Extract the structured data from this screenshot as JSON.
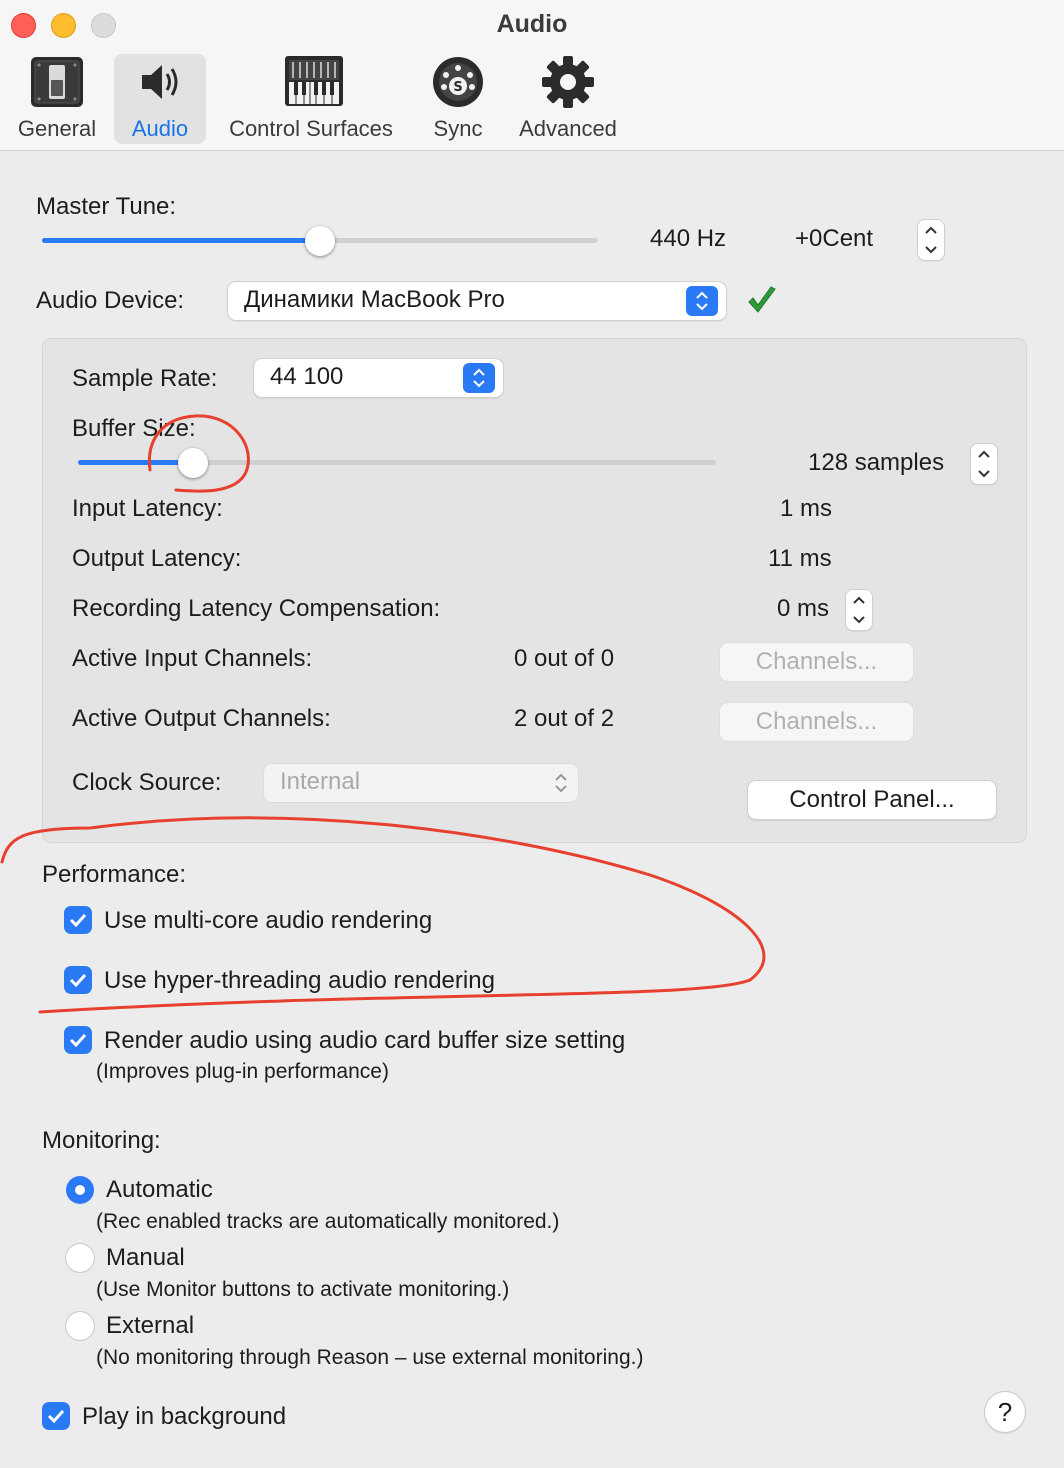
{
  "window": {
    "title": "Audio"
  },
  "toolbar": {
    "tabs": [
      {
        "label": "General",
        "icon": "general-switch-icon"
      },
      {
        "label": "Audio",
        "icon": "speaker-icon",
        "selected": true
      },
      {
        "label": "Control Surfaces",
        "icon": "piano-mixer-icon"
      },
      {
        "label": "Sync",
        "icon": "midi-sync-icon"
      },
      {
        "label": "Advanced",
        "icon": "gear-icon"
      }
    ]
  },
  "master_tune": {
    "label": "Master Tune:",
    "slider_level": 0.5,
    "hz": "440 Hz",
    "cent": "+0Cent"
  },
  "audio_device": {
    "label": "Audio Device:",
    "value": "Динамики MacBook Pro",
    "status_icon": "green-checkmark-icon"
  },
  "device_settings": {
    "sample_rate_label": "Sample Rate:",
    "sample_rate_value": "44 100",
    "buffer_size_label": "Buffer Size:",
    "buffer_size_value": "128 samples",
    "buffer_slider_level": 0.18,
    "input_latency_label": "Input Latency:",
    "input_latency_value": "1 ms",
    "output_latency_label": "Output Latency:",
    "output_latency_value": "11 ms",
    "rec_comp_label": "Recording Latency Compensation:",
    "rec_comp_value": "0 ms",
    "active_input_label": "Active Input Channels:",
    "active_input_value": "0 out of 0",
    "active_output_label": "Active Output Channels:",
    "active_output_value": "2 out of 2",
    "channels_button": "Channels...",
    "clock_source_label": "Clock Source:",
    "clock_source_value": "Internal",
    "control_panel_button": "Control Panel..."
  },
  "performance": {
    "heading": "Performance:",
    "multicore": "Use multi-core audio rendering",
    "hyperthreading": "Use hyper-threading audio rendering",
    "render_buffer": "Render audio using audio card buffer size setting",
    "render_buffer_note": "(Improves plug-in performance)"
  },
  "monitoring": {
    "heading": "Monitoring:",
    "options": [
      {
        "label": "Automatic",
        "note": "(Rec enabled tracks are automatically monitored.)",
        "selected": true
      },
      {
        "label": "Manual",
        "note": "(Use Monitor buttons to activate monitoring.)",
        "selected": false
      },
      {
        "label": "External",
        "note": "(No monitoring through Reason – use external monitoring.)",
        "selected": false
      }
    ]
  },
  "play_in_background": "Play in background",
  "help_button": "?",
  "colors": {
    "accent": "#2a7af5",
    "annotation": "#e8402f",
    "check_green": "#2e9a3a"
  }
}
